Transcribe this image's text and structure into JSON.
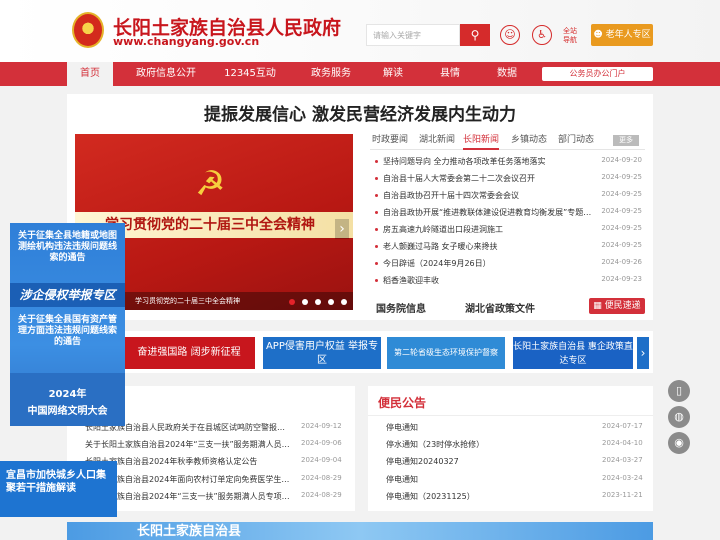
{
  "header": {
    "site_title": "长阳土家族自治县人民政府",
    "site_url": "www.changyang.gov.cn",
    "search_placeholder": "请输入关键字",
    "guide_label": "全站导航",
    "elder_button": "老年人专区"
  },
  "nav": {
    "items": [
      "首页",
      "政府信息公开",
      "12345互动",
      "政务服务",
      "解读",
      "县情",
      "数据"
    ],
    "portal": "公务员办公门户"
  },
  "main": {
    "headline": "提振发展信心 激发民营经济发展内生动力",
    "slider_banner": "学习贯彻党的二十届三中全会精神",
    "slider_caption": "学习贯彻党的二十届三中全会精神",
    "tabs": [
      "时政要闻",
      "湖北新闻",
      "长阳新闻",
      "乡镇动态",
      "部门动态"
    ],
    "active_tab": "长阳新闻",
    "more": "更多",
    "news": [
      {
        "title": "坚持问题导向 全力推动各项改革任务落地落实",
        "date": "2024-09-20"
      },
      {
        "title": "自治县十届人大常委会第二十二次会议召开",
        "date": "2024-09-25"
      },
      {
        "title": "自治县政协召开十届十四次常委会会议",
        "date": "2024-09-25"
      },
      {
        "title": "自治县政协开展“推进教联体建设促进教育均衡发展”专题…",
        "date": "2024-09-25"
      },
      {
        "title": "房五高速九岭隧道出口段进洞施工",
        "date": "2024-09-25"
      },
      {
        "title": "老人颤巍过马路 女子暖心来搀扶",
        "date": "2024-09-25"
      },
      {
        "title": "今日辟谣（2024年9月26日）",
        "date": "2024-09-26"
      },
      {
        "title": "稻香渔歌迎丰收",
        "date": "2024-09-23"
      }
    ],
    "bottom_links": [
      "国务院信息",
      "湖北省政策文件"
    ],
    "express_button": "便民速递"
  },
  "banners": [
    {
      "text": "奋进强国路 阔步新征程",
      "color": "#c8161d"
    },
    {
      "text": "APP侵害用户权益 举报专区",
      "color": "#1e6fc8"
    },
    {
      "text": "第二轮省级生态环境保护督察",
      "color": "#2f8bd6"
    },
    {
      "text": "长阳土家族自治县 惠企政策直达专区",
      "color": "#1a62c4"
    }
  ],
  "lower_left": {
    "items": [
      {
        "title": "长阳土家族自治县人民政府关于在县城区试鸣防空警报…",
        "date": "2024-09-12"
      },
      {
        "title": "关于长阳土家族自治县2024年“三支一扶”服务期满人员…",
        "date": "2024-09-06"
      },
      {
        "title": "长阳土家族自治县2024年秋季教师资格认定公告",
        "date": "2024-09-04"
      },
      {
        "title": "长阳土家族自治县2024年面向农村订单定向免费医学生…",
        "date": "2024-08-29"
      },
      {
        "title": "长阳土家族自治县2024年“三支一扶”服务期满人员专项…",
        "date": "2024-08-29"
      }
    ]
  },
  "lower_right": {
    "title": "便民公告",
    "items": [
      {
        "title": "停电通知",
        "date": "2024-07-17"
      },
      {
        "title": "停水通知（23时停水抢修）",
        "date": "2024-04-10"
      },
      {
        "title": "停电通知20240327",
        "date": "2024-03-27"
      },
      {
        "title": "停电通知",
        "date": "2024-03-24"
      },
      {
        "title": "停电通知（20231125）",
        "date": "2023-11-21"
      }
    ]
  },
  "bottom_strip": "长阳土家族自治县",
  "float_left": {
    "block1": "关于征集全县地籍或地图测绘机构违法违规问题线索的通告",
    "mid": "涉企侵权举报专区",
    "block2": "关于征集全县国有资产管理方面违法违规问题线索的通告",
    "year": "2024年",
    "conf": "中国网络文明大会"
  },
  "float_left2": "宜昌市加快城乡人口集聚若干措施解读",
  "colors": {
    "brand": "#d3303a",
    "accent": "#e99a1f"
  }
}
